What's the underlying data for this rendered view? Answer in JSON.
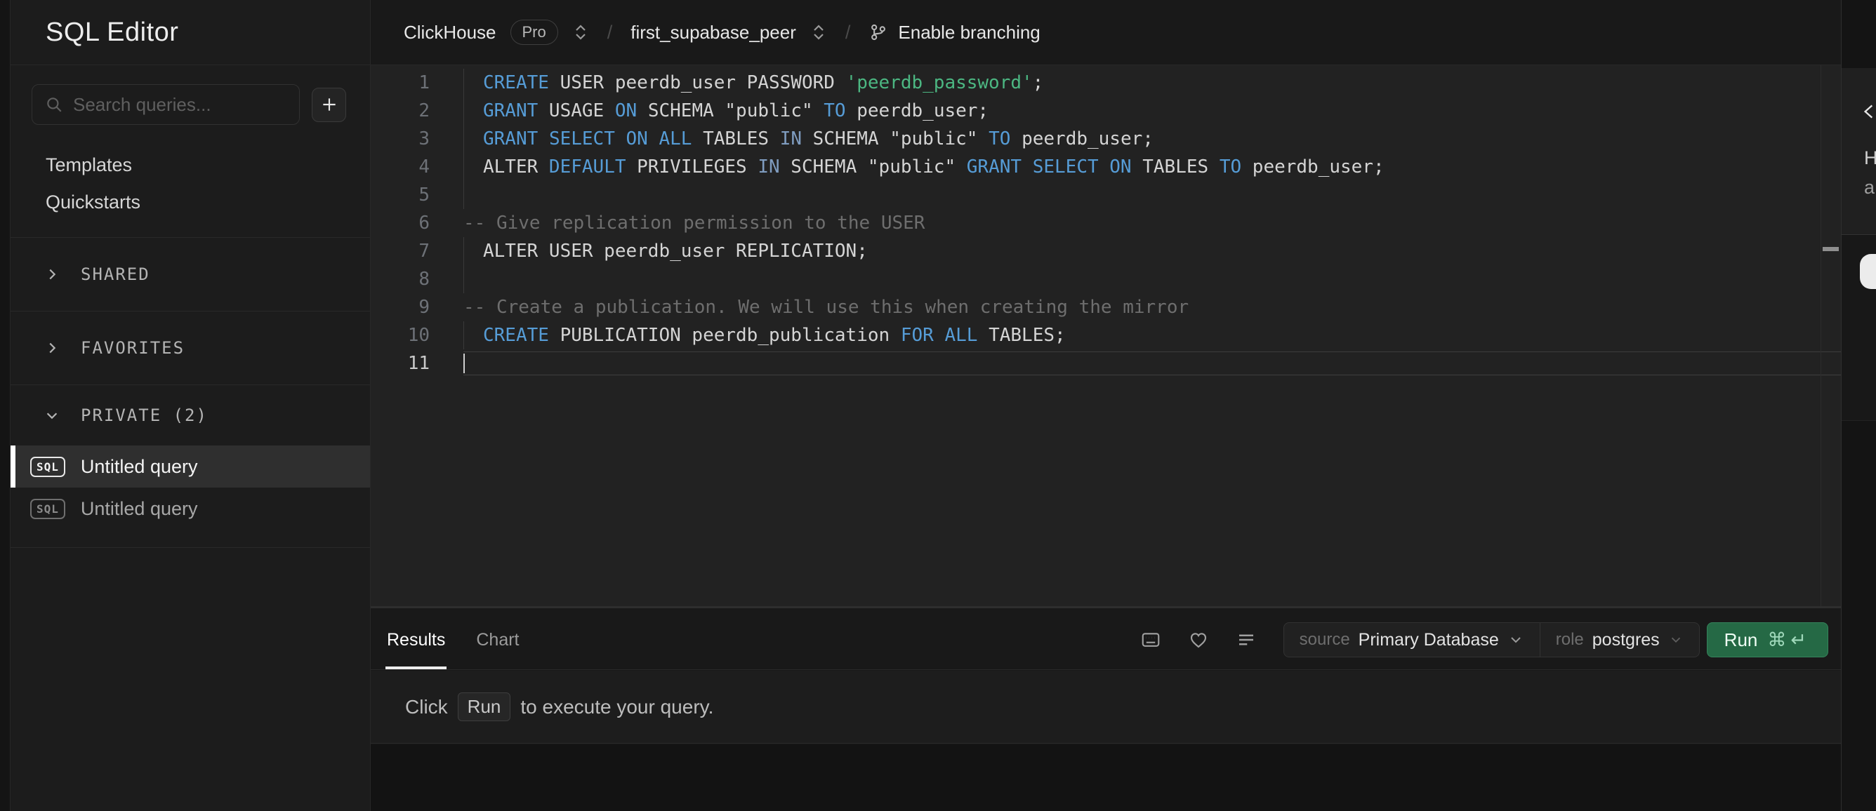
{
  "app": {
    "title": "SQL Editor"
  },
  "colors": {
    "page_bg": "#131313",
    "sidebar_bg": "#1c1c1c",
    "editor_bg": "#222222",
    "accent_green": "#3ecf8e",
    "run_button_bg": "#256945",
    "keyword_blue": "#569cd6",
    "keyword_dim_blue": "#7f9cbf",
    "string_green": "#4cb782",
    "comment_gray": "#6e6e6e",
    "selected_row_bg": "#2f2f2f"
  },
  "sidebar": {
    "search": {
      "placeholder": "Search queries..."
    },
    "new_query_button": "+",
    "links": [
      {
        "label": "Templates"
      },
      {
        "label": "Quickstarts"
      }
    ],
    "sections": [
      {
        "label": "SHARED",
        "collapsed": true
      },
      {
        "label": "FAVORITES",
        "collapsed": true
      },
      {
        "label": "PRIVATE (2)",
        "collapsed": false
      }
    ],
    "queries": [
      {
        "badge": "SQL",
        "label": "Untitled query",
        "selected": true
      },
      {
        "badge": "SQL",
        "label": "Untitled query",
        "selected": false
      }
    ]
  },
  "header": {
    "org": "ClickHouse",
    "plan_badge": "Pro",
    "separator": "/",
    "project": "first_supabase_peer",
    "branch_action": "Enable branching"
  },
  "editor": {
    "line_count": 11,
    "cursor_line": 11,
    "token_colors": {
      "b": "#569cd6",
      "i": "#7f9cbf",
      "w": "#d4d4d4",
      "s": "#4cb782",
      "c": "#6e6e6e"
    },
    "lines": [
      {
        "num": 1,
        "guide": true,
        "tokens": [
          [
            "CREATE",
            "b"
          ],
          [
            " USER peerdb_user PASSWORD ",
            "w"
          ],
          [
            "'peerdb_password'",
            "s"
          ],
          [
            ";",
            "w"
          ]
        ]
      },
      {
        "num": 2,
        "guide": true,
        "tokens": [
          [
            "GRANT",
            "b"
          ],
          [
            " USAGE ",
            "w"
          ],
          [
            "ON",
            "b"
          ],
          [
            " SCHEMA \"public\" ",
            "w"
          ],
          [
            "TO",
            "b"
          ],
          [
            " peerdb_user;",
            "w"
          ]
        ]
      },
      {
        "num": 3,
        "guide": true,
        "tokens": [
          [
            "GRANT",
            "b"
          ],
          [
            " ",
            "w"
          ],
          [
            "SELECT",
            "b"
          ],
          [
            " ",
            "w"
          ],
          [
            "ON",
            "b"
          ],
          [
            " ",
            "w"
          ],
          [
            "ALL",
            "b"
          ],
          [
            " TABLES ",
            "w"
          ],
          [
            "IN",
            "i"
          ],
          [
            " SCHEMA \"public\" ",
            "w"
          ],
          [
            "TO",
            "b"
          ],
          [
            " peerdb_user;",
            "w"
          ]
        ]
      },
      {
        "num": 4,
        "guide": true,
        "tokens": [
          [
            "ALTER ",
            "w"
          ],
          [
            "DEFAULT",
            "b"
          ],
          [
            " PRIVILEGES ",
            "w"
          ],
          [
            "IN",
            "i"
          ],
          [
            " SCHEMA \"public\" ",
            "w"
          ],
          [
            "GRANT",
            "b"
          ],
          [
            " ",
            "w"
          ],
          [
            "SELECT",
            "b"
          ],
          [
            " ",
            "w"
          ],
          [
            "ON",
            "b"
          ],
          [
            " TABLES ",
            "w"
          ],
          [
            "TO",
            "b"
          ],
          [
            " peerdb_user;",
            "w"
          ]
        ]
      },
      {
        "num": 5,
        "guide": true,
        "tokens": []
      },
      {
        "num": 6,
        "comment": true,
        "tokens": [
          [
            "-- Give replication permission to the USER",
            "c"
          ]
        ]
      },
      {
        "num": 7,
        "guide": true,
        "tokens": [
          [
            "ALTER USER peerdb_user REPLICATION;",
            "w"
          ]
        ]
      },
      {
        "num": 8,
        "guide": true,
        "tokens": []
      },
      {
        "num": 9,
        "comment": true,
        "tokens": [
          [
            "-- Create a publication. We will use this when creating the mirror",
            "c"
          ]
        ]
      },
      {
        "num": 10,
        "guide": true,
        "tokens": [
          [
            "CREATE",
            "b"
          ],
          [
            " PUBLICATION peerdb_publication ",
            "w"
          ],
          [
            "FOR",
            "b"
          ],
          [
            " ",
            "w"
          ],
          [
            "ALL",
            "b"
          ],
          [
            " TABLES;",
            "w"
          ]
        ]
      },
      {
        "num": 11,
        "current": true,
        "tokens": []
      }
    ]
  },
  "results": {
    "tabs": [
      {
        "label": "Results",
        "active": true
      },
      {
        "label": "Chart",
        "active": false
      }
    ],
    "icons": [
      "keyboard-icon",
      "heart-icon",
      "lines-icon"
    ],
    "source_label": "source",
    "source_value": "Primary Database",
    "role_label": "role",
    "role_value": "postgres",
    "run_label": "Run",
    "run_shortcut_cmd": "⌘",
    "run_shortcut_enter": "↵",
    "hint": {
      "prefix": "Click",
      "key": "Run",
      "suffix": "to execute your query."
    }
  },
  "right_panel": {
    "fragments": [
      "H",
      "a"
    ]
  }
}
